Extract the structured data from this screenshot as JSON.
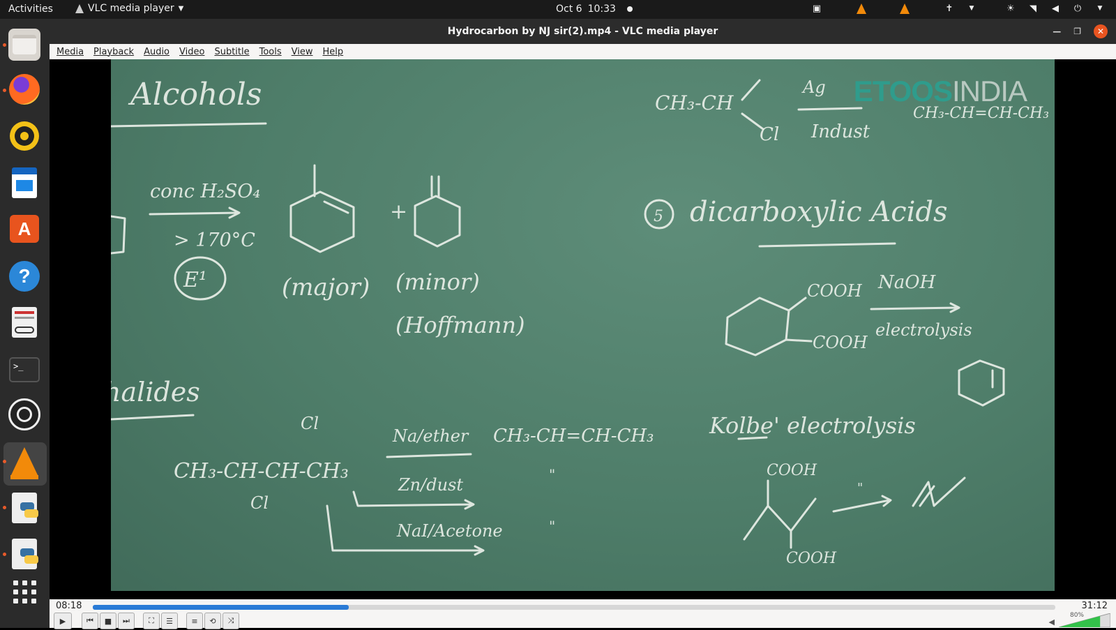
{
  "topbar": {
    "activities": "Activities",
    "app_name": "VLC media player",
    "date": "Oct 6",
    "time": "10:33"
  },
  "window": {
    "title": "Hydrocarbon by NJ sir(2).mp4 - VLC media player"
  },
  "menu": [
    "Media",
    "Playback",
    "Audio",
    "Video",
    "Subtitle",
    "Tools",
    "View",
    "Help"
  ],
  "video": {
    "watermark_a": "ETOOS",
    "watermark_b": "INDIA",
    "board_text": {
      "heading_alcohols": "Alcohols",
      "reagent1": "conc H₂SO₄",
      "temp": "> 170°C",
      "e1": "E¹",
      "major": "(major)",
      "minor": "(minor)",
      "hoffmann": "(Hoffmann)",
      "heading_dicarb": "(5) dicarboxylic Acids",
      "cooh1": "COOH",
      "cooh2": "COOH",
      "naoh": "NaOH",
      "electrolysis": "electrolysis",
      "kolbe": "Kolbe' electrolysis",
      "halides": "halides",
      "na_ether": "Na/ether",
      "zn_dust": "Zn/dust",
      "nai_acetone": "NaI/Acetone",
      "product": "CH₃-CH=CH-CH₃",
      "reactant": "CH₃-CH-CH-CH₃",
      "cl1": "Cl",
      "cl2": "Cl",
      "top_right_a": "CH₃-CH",
      "top_right_b": "Ag",
      "top_right_c": "Indust",
      "top_right_d": "CH₃-CH=CH-CH₃",
      "cooh3": "COOH",
      "cooh4": "COOH",
      "ditto1": "\"",
      "ditto2": "\""
    }
  },
  "playback": {
    "elapsed": "08:18",
    "total": "31:12",
    "progress": 0.266,
    "volume": "80%",
    "volume_level": 0.8
  }
}
